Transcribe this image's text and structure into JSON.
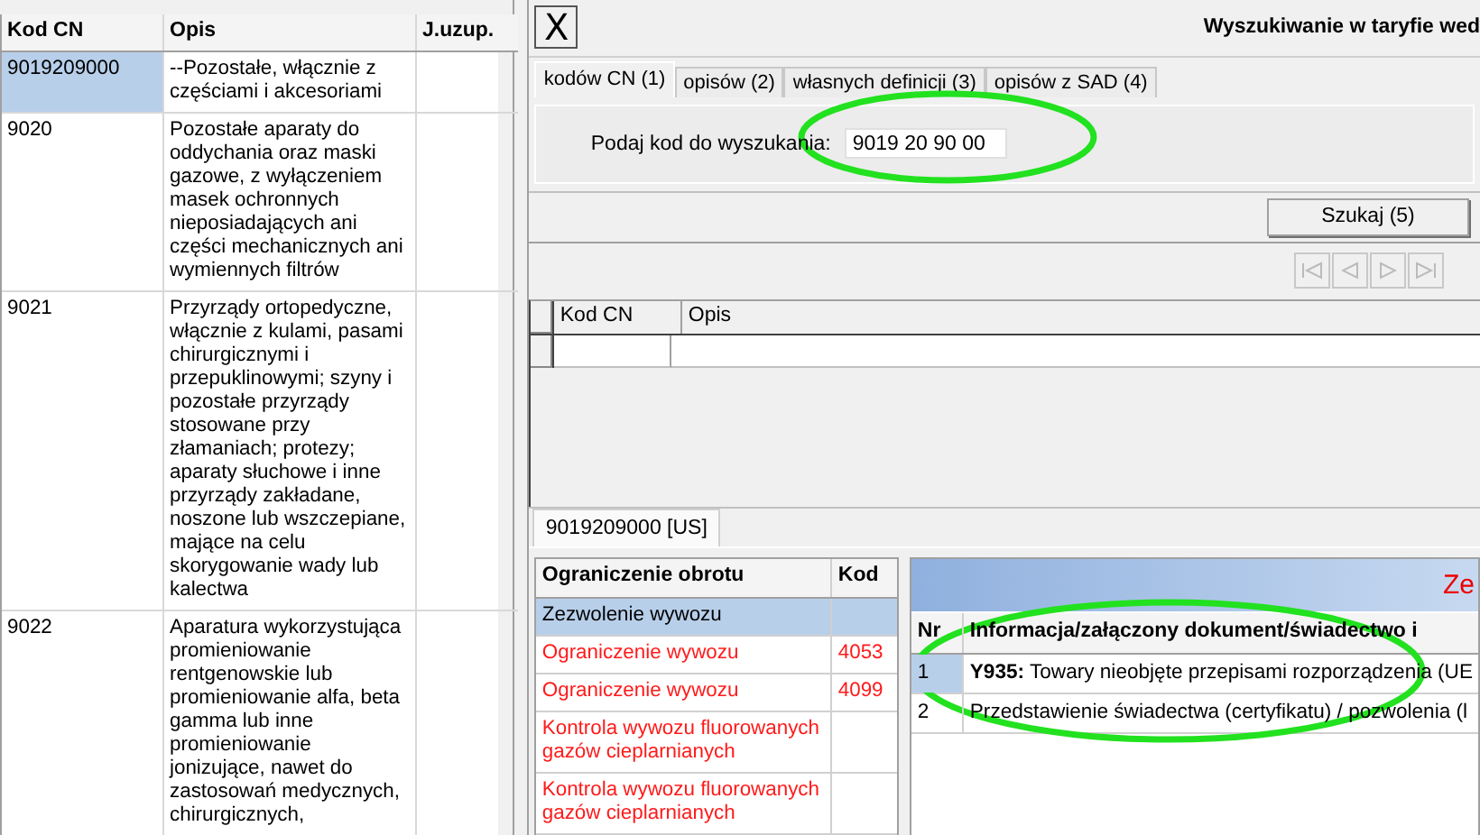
{
  "cn_table": {
    "columns": [
      "Kod CN",
      "Opis",
      "J.uzup."
    ],
    "rows": [
      {
        "code": "9019209000",
        "description": "--Pozostałe, włącznie z częściami i akcesoriami",
        "unit": "",
        "selected": true
      },
      {
        "code": "9020",
        "description": "Pozostałe aparaty do oddychania oraz maski gazowe, z wyłączeniem masek ochronnych nieposiadających ani części mechanicznych ani wymiennych filtrów",
        "unit": "",
        "selected": false
      },
      {
        "code": "9021",
        "description": "Przyrządy ortopedyczne, włącznie z kulami, pasami chirurgicznymi i przepuklinowymi; szyny i pozostałe przyrządy stosowane przy złamaniach; protezy; aparaty słuchowe i inne przyrządy zakładane, noszone lub wszczepiane, mające na celu skorygowanie wady lub kalectwa",
        "unit": "",
        "selected": false
      },
      {
        "code": "9022",
        "description": "Aparatura wykorzystująca promieniowanie rentgenowskie lub promieniowanie alfa, beta gamma lub inne promieniowanie jonizujące, nawet do zastosowań medycznych, chirurgicznych,",
        "unit": "",
        "selected": false
      }
    ]
  },
  "search_window": {
    "close": "X",
    "title": "Wyszukiwanie w taryfie wed",
    "tabs": [
      {
        "label": "kodów CN (1)",
        "selected": true
      },
      {
        "label": "opisów (2)",
        "selected": false
      },
      {
        "label": "własnych definicji (3)",
        "selected": false
      },
      {
        "label": "opisów z SAD (4)",
        "selected": false
      }
    ],
    "field_label": "Podaj kod do wyszukania:",
    "field_value": "9019 20 90 00",
    "search_button": "Szukaj (5)",
    "results": {
      "columns": [
        "Kod CN",
        "Opis"
      ]
    }
  },
  "detail_tab": {
    "label": "9019209000 [US]",
    "selected": true
  },
  "restrictions": {
    "columns": [
      "Ograniczenie obrotu",
      "Kod"
    ],
    "rows": [
      {
        "name": "Zezwolenie wywozu",
        "code": "",
        "selected": true,
        "warning": false
      },
      {
        "name": "Ograniczenie wywozu",
        "code": "4053",
        "selected": false,
        "warning": true
      },
      {
        "name": "Ograniczenie wywozu",
        "code": "4099",
        "selected": false,
        "warning": true
      },
      {
        "name": "Kontrola wywozu fluorowanych gazów cieplarnianych",
        "code": "",
        "selected": false,
        "warning": true
      },
      {
        "name": "Kontrola wywozu fluorowanych gazów cieplarnianych",
        "code": "",
        "selected": false,
        "warning": true
      }
    ]
  },
  "documents": {
    "heading": "Ze",
    "columns": [
      "Nr",
      "Informacja/załączony dokument/świadectwo i"
    ],
    "rows": [
      {
        "nr": "1",
        "text": "**Y935:** Towary nieobjęte przepisami rozporządzenia (UE",
        "selected": true
      },
      {
        "nr": "2",
        "text": "Przedstawienie świadectwa (certyfikatu) / pozwolenia (l",
        "selected": false
      }
    ]
  },
  "annotations": [
    {
      "kind": "ellipse"
    },
    {
      "kind": "ellipse"
    }
  ]
}
